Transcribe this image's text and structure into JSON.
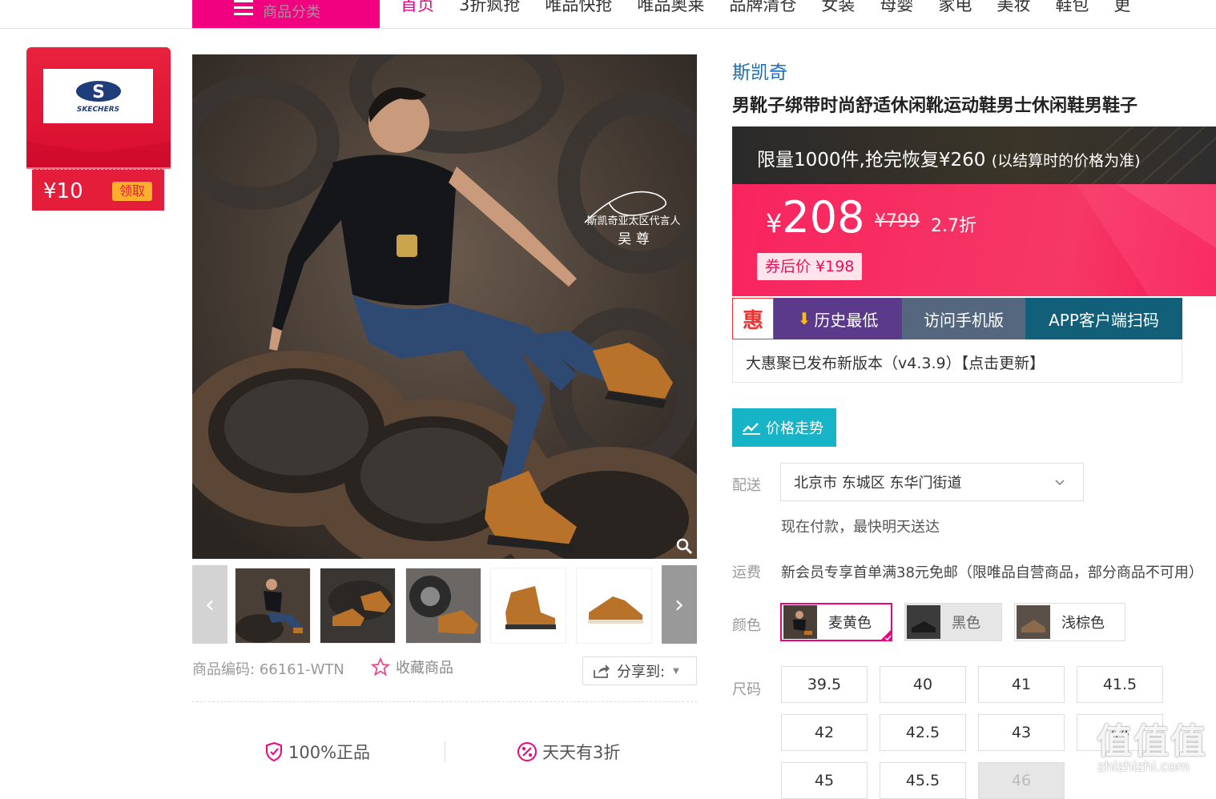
{
  "nav": {
    "category_label": "商品分类",
    "links": [
      "首页",
      "3折疯抢",
      "唯品快抢",
      "唯品奥莱",
      "品牌清仓",
      "女装",
      "母婴",
      "家电",
      "美妆",
      "鞋包",
      "更"
    ]
  },
  "coupon": {
    "brand_logo_text": "SKECHERS",
    "amount": "¥10",
    "get_label": "领取"
  },
  "image": {
    "endorser_title": "斯凯奇亚太区代言人",
    "endorser_name": "吴 尊"
  },
  "product": {
    "brand": "斯凯奇",
    "title": "男靴子绑带时尚舒适休闲靴运动鞋男士休闲鞋男鞋子",
    "code_label": "商品编码:",
    "code": "66161-WTN",
    "favorite_label": "收藏商品",
    "share_label": "分享到:"
  },
  "promo": {
    "text": "限量1000件,抢完恢复¥260",
    "note": "(以结算时的价格为准)"
  },
  "price": {
    "currency": "¥",
    "current": "208",
    "original": "¥799",
    "discount": "2.7折",
    "after_coupon": "券后价 ¥198"
  },
  "extension": {
    "logo_char": "惠",
    "history_low": "历史最低",
    "mobile": "访问手机版",
    "app_scan": "APP客户端扫码",
    "notice": "大惠聚已发布新版本（v4.3.9）【点击更新】",
    "trend": "价格走势"
  },
  "delivery": {
    "label": "配送",
    "address": "北京市 东城区 东华门街道",
    "eta": "现在付款，最快明天送达",
    "shipping_label": "运费",
    "shipping_text": "新会员专享首单满38元免邮（限唯品自营商品，部分商品不可用）"
  },
  "colors": {
    "label": "颜色",
    "options": [
      "麦黄色",
      "黑色",
      "浅棕色"
    ]
  },
  "sizes": {
    "label": "尺码",
    "options": [
      "39.5",
      "40",
      "41",
      "41.5",
      "42",
      "42.5",
      "43",
      "44",
      "45",
      "45.5",
      "46"
    ]
  },
  "guarantees": [
    "100%正品",
    "天天有3折"
  ],
  "watermark": {
    "logo": "值值值",
    "url": "zhizhizhi.com"
  },
  "colors_theme": {
    "brand_pink": "#f10180",
    "price_red": "#f9245e",
    "purple": "#5b3a8c",
    "slate": "#55667f",
    "teal": "#125f7a",
    "trend_teal": "#17b3c6"
  }
}
